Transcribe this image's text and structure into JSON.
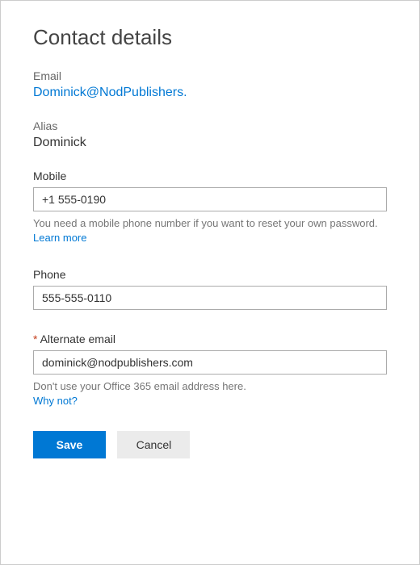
{
  "page_title": "Contact details",
  "email": {
    "label": "Email",
    "value": "Dominick@NodPublishers."
  },
  "alias": {
    "label": "Alias",
    "value": "Dominick"
  },
  "mobile": {
    "label": "Mobile",
    "value": "+1 555-0190",
    "help_text": "You need a mobile phone number if you want to reset your own password.",
    "learn_more": "Learn more"
  },
  "phone": {
    "label": "Phone",
    "value": "555-555-0110"
  },
  "alternate_email": {
    "label": "Alternate email",
    "required_marker": "*",
    "value": "dominick@nodpublishers.com",
    "help_text": "Don't use your Office 365 email address here.",
    "why_not": "Why not?"
  },
  "buttons": {
    "save": "Save",
    "cancel": "Cancel"
  }
}
